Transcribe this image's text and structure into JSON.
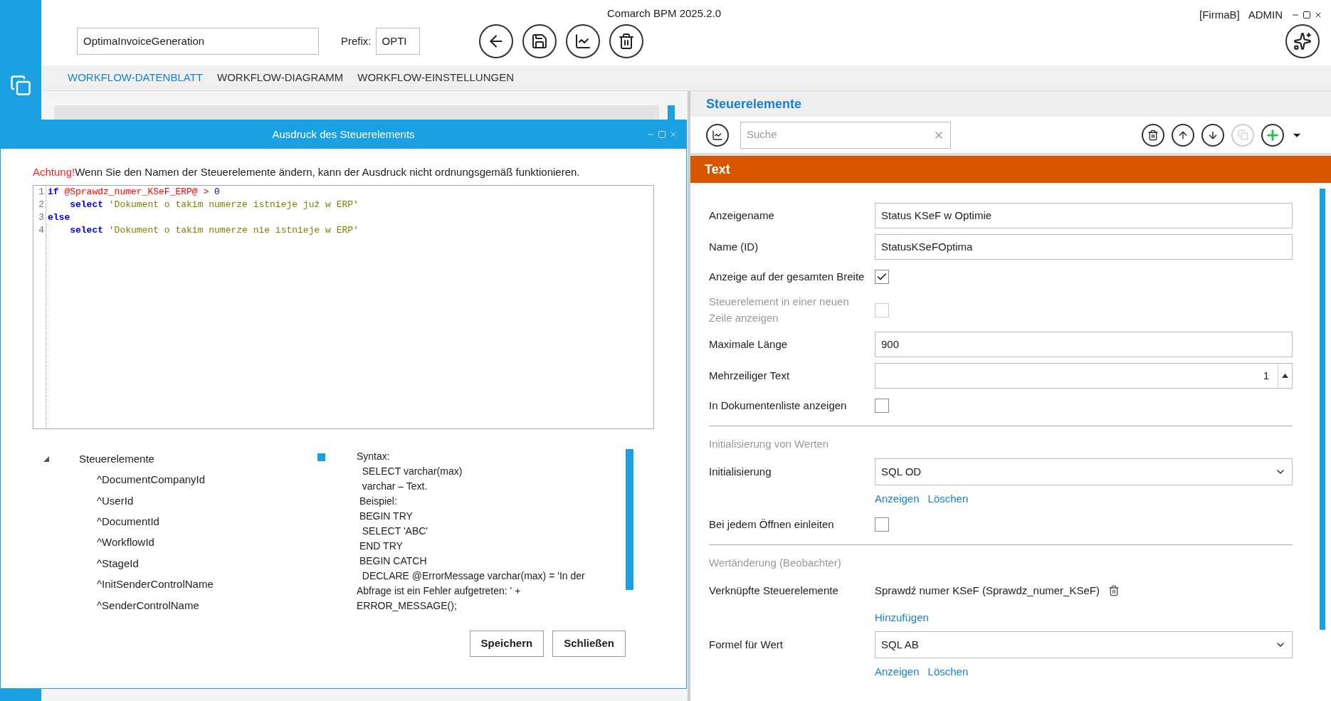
{
  "app": {
    "title": "Comarch BPM 2025.2.0",
    "company": "[FirmaB]",
    "user": "ADMIN"
  },
  "workflow": {
    "name": "OptimaInvoiceGeneration",
    "prefix_label": "Prefix:",
    "prefix": "OPTI"
  },
  "tabs": [
    {
      "label": "WORKFLOW-DATENBLATT",
      "selected": true
    },
    {
      "label": "WORKFLOW-DIAGRAMM",
      "selected": false
    },
    {
      "label": "WORKFLOW-EINSTELLUNGEN",
      "selected": false
    }
  ],
  "dialog": {
    "title": "Ausdruck des Steuerelements",
    "warning_label": "Achtung!",
    "warning": "Wenn Sie den Namen der Steuerelemente ändern, kann der Ausdruck nicht ordnungsgemäß funktionieren.",
    "code": [
      {
        "number": "1",
        "indent": false,
        "tokens": [
          {
            "kind": "keyword",
            "text": "if"
          },
          {
            "kind": "variable",
            "text": "@Sprawdz_numer_KSeF_ERP@ >"
          },
          {
            "kind": "number",
            "text": "0"
          }
        ]
      },
      {
        "number": "2",
        "indent": true,
        "tokens": [
          {
            "kind": "keyword",
            "text": "select"
          },
          {
            "kind": "string",
            "text": "'Dokument o takim numerze istnieje już w ERP'"
          }
        ]
      },
      {
        "number": "3",
        "indent": false,
        "tokens": [
          {
            "kind": "keyword",
            "text": "else"
          }
        ]
      },
      {
        "number": "4",
        "indent": true,
        "tokens": [
          {
            "kind": "keyword",
            "text": "select"
          },
          {
            "kind": "string",
            "text": "'Dokument o takim numerze nie istnieje w ERP'"
          }
        ]
      }
    ],
    "tree": {
      "label": "Steuerelemente",
      "expanded": true,
      "children": [
        {
          "label": "^DocumentCompanyId"
        },
        {
          "label": "^UserId"
        },
        {
          "label": "^DocumentId"
        },
        {
          "label": "^WorkflowId"
        },
        {
          "label": "^StageId"
        },
        {
          "label": "^InitSenderControlName"
        },
        {
          "label": "^SenderControlName"
        }
      ]
    },
    "help": [
      "Syntax:",
      "  SELECT varchar(max)",
      "  varchar – Text.",
      " Beispiel:",
      " BEGIN TRY",
      "  SELECT 'ABC'",
      " END TRY",
      " BEGIN CATCH",
      "  DECLARE @ErrorMessage varchar(max) = 'In der Abfrage ist ein Fehler aufgetreten: ' + ERROR_MESSAGE();"
    ],
    "buttons": [
      "Speichern",
      "Schließen"
    ]
  },
  "panel": {
    "title": "Steuerelemente",
    "search": {
      "placeholder": "Suche"
    },
    "section": "Text",
    "rows": [
      {
        "kind": "text",
        "label": "Anzeigename",
        "value": "Status KSeF w Optimie"
      },
      {
        "kind": "text",
        "label": "Name (ID)",
        "value": "StatusKSeFOptima"
      },
      {
        "kind": "checkbox",
        "label": "Anzeige auf der gesamten Breite",
        "checked": true,
        "disabled": false
      },
      {
        "kind": "checkbox",
        "label": "Steuerelement in einer neuen Zeile anzeigen",
        "checked": false,
        "disabled": true
      },
      {
        "kind": "text",
        "label": "Maximale Länge",
        "value": "900"
      },
      {
        "kind": "spinner",
        "label": "Mehrzeiliger Text",
        "value": "1"
      },
      {
        "kind": "checkbox",
        "label": "In Dokumentenliste anzeigen",
        "checked": false,
        "disabled": false
      },
      {
        "kind": "divider"
      },
      {
        "kind": "section",
        "label": "Initialisierung von Werten"
      },
      {
        "kind": "select",
        "label": "Initialisierung",
        "value": "SQL OD"
      },
      {
        "kind": "links",
        "links": [
          "Anzeigen",
          "Löschen"
        ]
      },
      {
        "kind": "checkbox",
        "label": "Bei jedem Öffnen einleiten",
        "checked": false,
        "disabled": false
      },
      {
        "kind": "divider"
      },
      {
        "kind": "section",
        "label": "Wertänderung (Beobachter)"
      },
      {
        "kind": "linked",
        "label": "Verknüpfte Steuerelemente",
        "value": "Sprawdź numer KSeF (Sprawdz_numer_KSeF)"
      },
      {
        "kind": "links",
        "links": [
          "Hinzufügen"
        ]
      },
      {
        "kind": "select",
        "label": "Formel für Wert",
        "value": "SQL AB"
      },
      {
        "kind": "links",
        "links": [
          "Anzeigen",
          "Löschen"
        ]
      }
    ]
  }
}
